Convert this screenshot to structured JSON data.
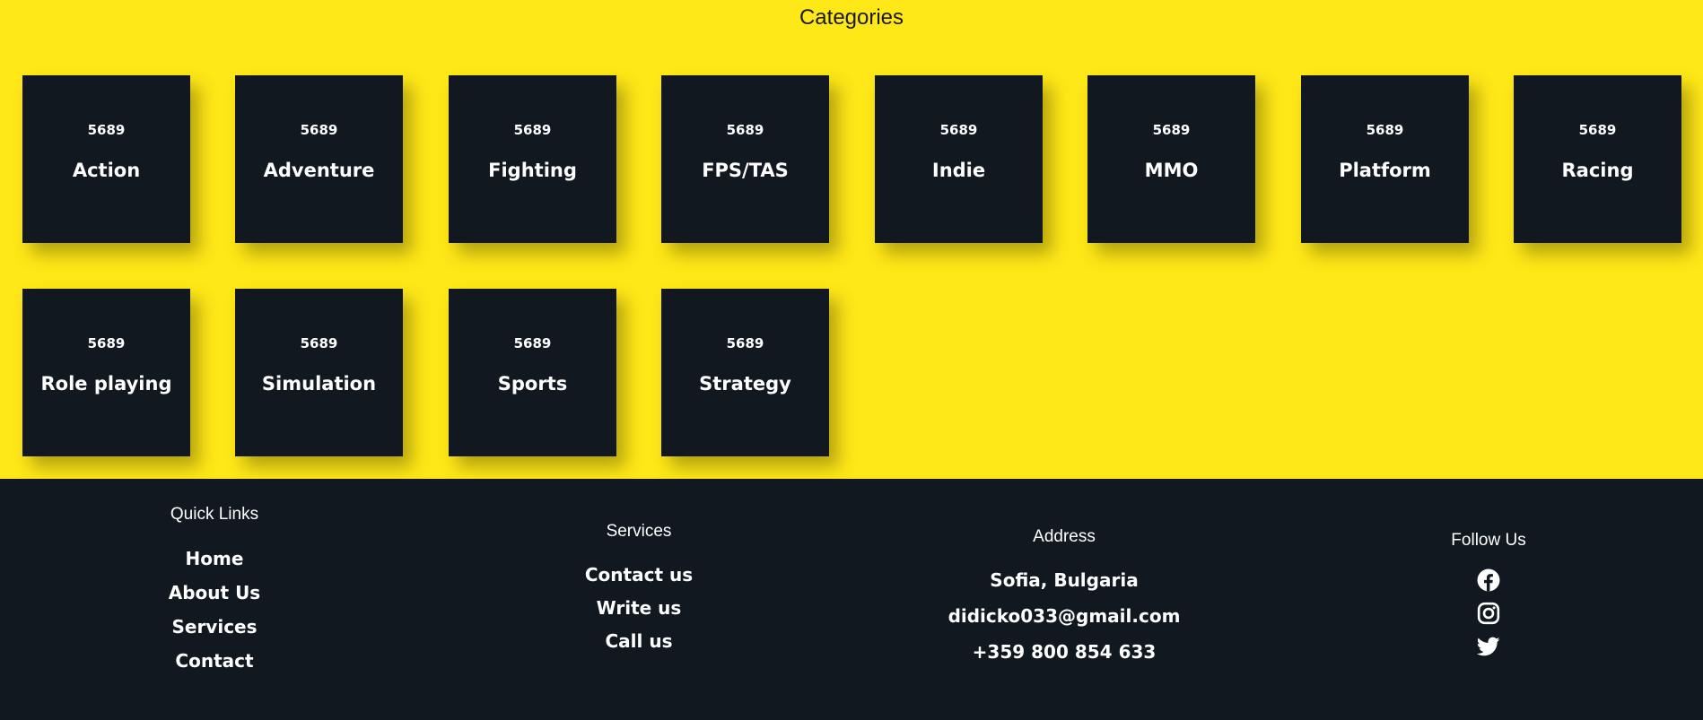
{
  "categories": {
    "title": "Categories",
    "items": [
      {
        "count": "5689",
        "name": "Action"
      },
      {
        "count": "5689",
        "name": "Adventure"
      },
      {
        "count": "5689",
        "name": "Fighting"
      },
      {
        "count": "5689",
        "name": "FPS/TAS"
      },
      {
        "count": "5689",
        "name": "Indie"
      },
      {
        "count": "5689",
        "name": "MMO"
      },
      {
        "count": "5689",
        "name": "Platform"
      },
      {
        "count": "5689",
        "name": "Racing"
      },
      {
        "count": "5689",
        "name": "Role playing"
      },
      {
        "count": "5689",
        "name": "Simulation"
      },
      {
        "count": "5689",
        "name": "Sports"
      },
      {
        "count": "5689",
        "name": "Strategy"
      }
    ]
  },
  "footer": {
    "quick_links": {
      "heading": "Quick Links",
      "links": [
        "Home",
        "About Us",
        "Services",
        "Contact"
      ]
    },
    "services": {
      "heading": "Services",
      "links": [
        "Contact us",
        "Write us",
        "Call us"
      ]
    },
    "address": {
      "heading": "Address",
      "lines": [
        "Sofia, Bulgaria",
        "didicko033@gmail.com",
        "+359 800 854 633"
      ]
    },
    "follow": {
      "heading": "Follow Us",
      "icons": [
        "facebook-icon",
        "instagram-icon",
        "twitter-icon"
      ]
    }
  },
  "colors": {
    "accent_yellow": "#ffe817",
    "dark": "#111820",
    "text_light": "#ffffff"
  }
}
